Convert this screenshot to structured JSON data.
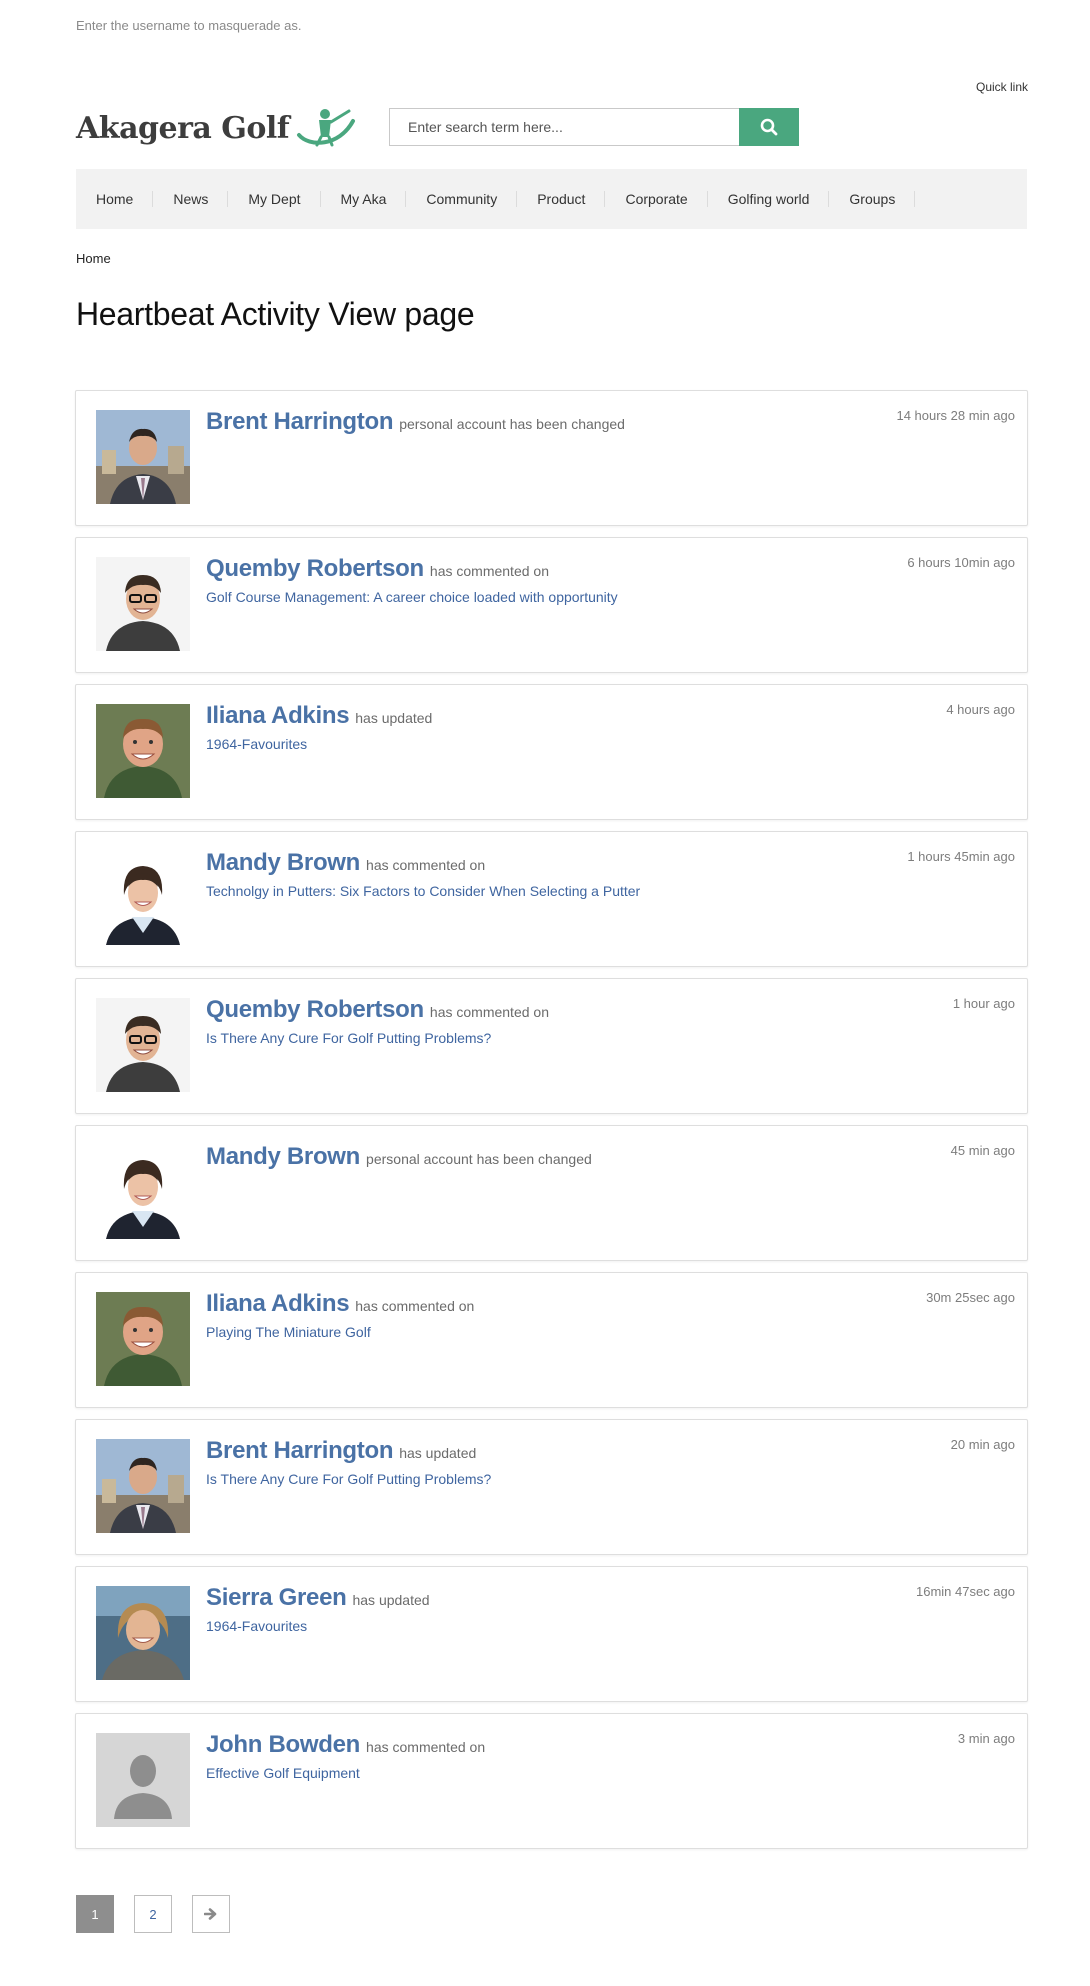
{
  "masquerade_hint": "Enter the username to masquerade as.",
  "quick_link": "Quick link",
  "site": {
    "logo_text": "Akagera Golf"
  },
  "search": {
    "placeholder": "Enter search term here..."
  },
  "nav": {
    "items": [
      "Home",
      "News",
      "My Dept",
      "My Aka",
      "Community",
      "Product",
      "Corporate",
      "Golfing world",
      "Groups"
    ]
  },
  "breadcrumb": "Home",
  "page_title": "Heartbeat Activity View page",
  "feed": [
    {
      "name": "Brent Harrington",
      "action": "personal account has been changed",
      "target": "",
      "time": "14 hours 28 min ago",
      "avatar": "brent"
    },
    {
      "name": "Quemby Robertson",
      "action": "has commented on",
      "target": "Golf Course Management: A career choice loaded with opportunity",
      "time": "6 hours 10min ago",
      "avatar": "quemby"
    },
    {
      "name": "Iliana Adkins",
      "action": "has updated",
      "target": "1964-Favourites",
      "time": "4 hours ago",
      "avatar": "iliana"
    },
    {
      "name": "Mandy Brown",
      "action": "has commented on",
      "target": "Technolgy in Putters: Six Factors to Consider When Selecting a Putter",
      "time": "1 hours 45min ago",
      "avatar": "mandy"
    },
    {
      "name": "Quemby Robertson",
      "action": "has commented on",
      "target": "Is There Any Cure For Golf Putting Problems?",
      "time": "1 hour ago",
      "avatar": "quemby"
    },
    {
      "name": "Mandy Brown",
      "action": "personal account has been changed",
      "target": "",
      "time": "45 min ago",
      "avatar": "mandy"
    },
    {
      "name": "Iliana Adkins",
      "action": "has commented on",
      "target": "Playing The Miniature Golf",
      "time": "30m 25sec ago",
      "avatar": "iliana"
    },
    {
      "name": "Brent Harrington",
      "action": "has updated",
      "target": "Is There Any Cure For Golf Putting Problems?",
      "time": "20 min ago",
      "avatar": "brent"
    },
    {
      "name": "Sierra Green",
      "action": "has updated",
      "target": "1964-Favourites",
      "time": "16min 47sec ago",
      "avatar": "sierra"
    },
    {
      "name": "John Bowden",
      "action": "has commented on",
      "target": "Effective Golf Equipment",
      "time": "3 min ago",
      "avatar": "default"
    }
  ],
  "pager": {
    "pages": [
      "1",
      "2"
    ],
    "current": "1",
    "next_icon": "arrow-right-icon"
  },
  "colors": {
    "brand_green": "#4aa77f",
    "link_blue": "#4a72a6",
    "nav_bg": "#f2f2f2"
  }
}
